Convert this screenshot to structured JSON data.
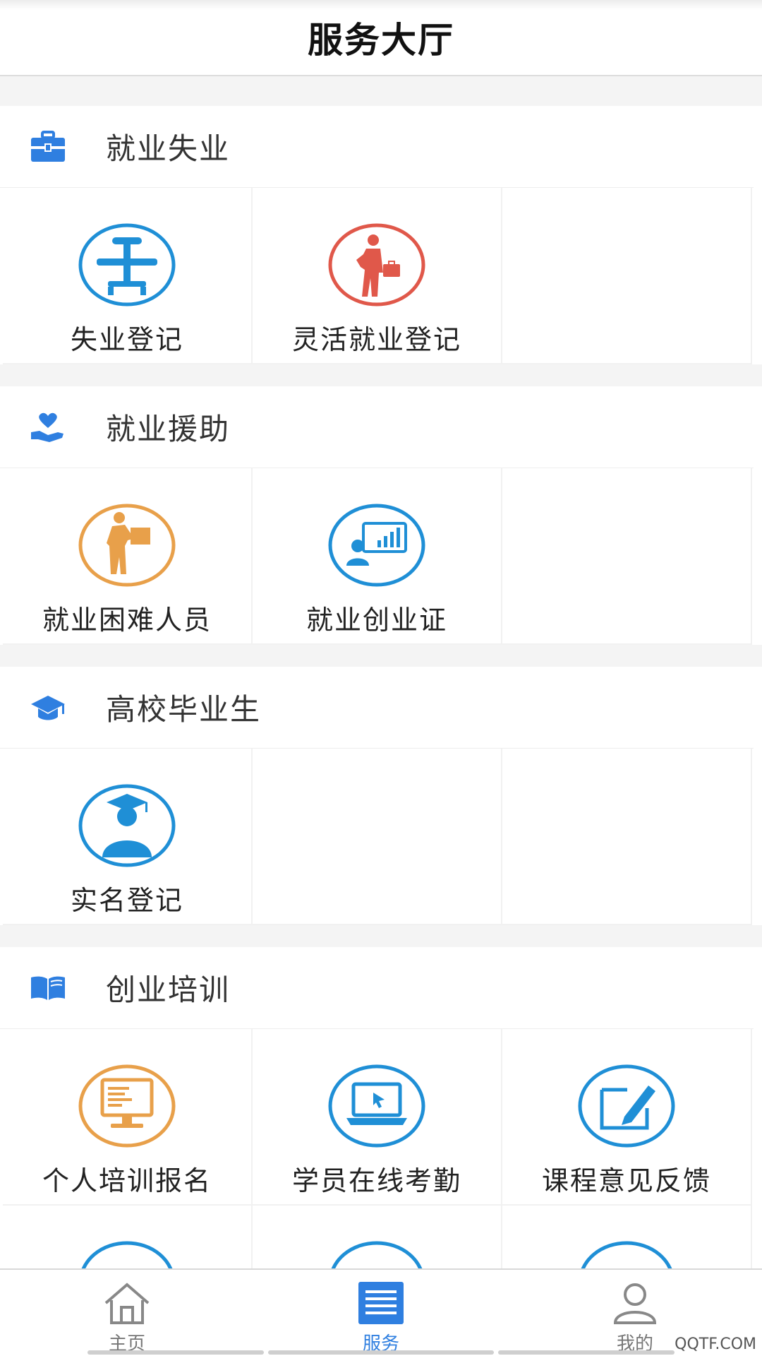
{
  "header": {
    "title": "服务大厅"
  },
  "sections": [
    {
      "title": "就业失业",
      "items": [
        {
          "label": "失业登记"
        },
        {
          "label": "灵活就业登记"
        }
      ]
    },
    {
      "title": "就业援助",
      "items": [
        {
          "label": "就业困难人员"
        },
        {
          "label": "就业创业证"
        }
      ]
    },
    {
      "title": "高校毕业生",
      "items": [
        {
          "label": "实名登记"
        }
      ]
    },
    {
      "title": "创业培训",
      "items": [
        {
          "label": "个人培训报名"
        },
        {
          "label": "学员在线考勤"
        },
        {
          "label": "课程意见反馈"
        }
      ]
    }
  ],
  "tabs": [
    {
      "label": "主页"
    },
    {
      "label": "服务"
    },
    {
      "label": "我的"
    }
  ],
  "watermark": "QQTF.COM",
  "colors": {
    "blue": "#1f8fd6",
    "red": "#e0584a",
    "orange": "#e8a04a",
    "section_icon_blue": "#2f7fe0",
    "active_tab": "#2f7fe0"
  }
}
